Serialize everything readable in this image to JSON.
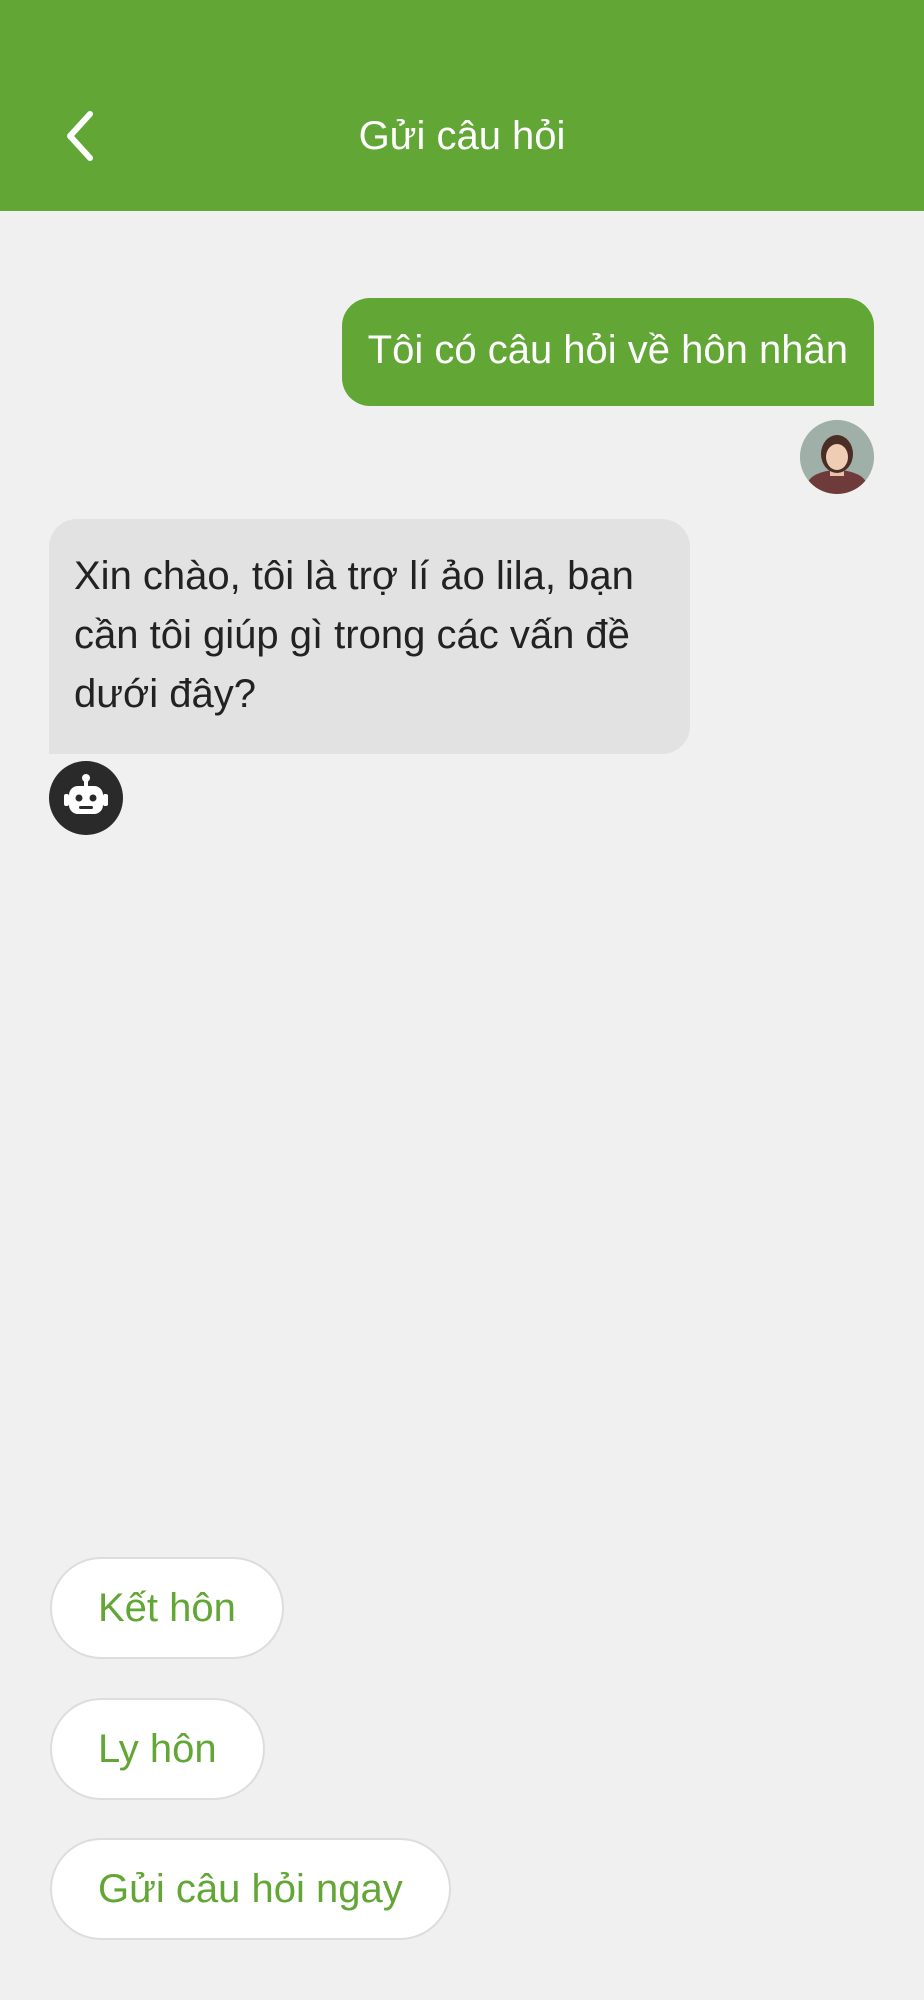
{
  "header": {
    "title": "Gửi câu hỏi",
    "background_color": "#62a636",
    "back_icon": "chevron-left-icon"
  },
  "messages": [
    {
      "sender": "user",
      "text": "Tôi có câu hỏi về hôn nhân",
      "avatar": "user-avatar-photo"
    },
    {
      "sender": "bot",
      "text": "Xin chào, tôi là trợ lí ảo lila, bạn cần tôi giúp gì trong các vấn đề dưới đây?",
      "avatar": "robot-icon"
    }
  ],
  "quick_replies": [
    {
      "label": "Kết hôn"
    },
    {
      "label": "Ly hôn"
    },
    {
      "label": "Gửi câu hỏi ngay"
    }
  ],
  "colors": {
    "accent": "#62a636",
    "page_background": "#f0f0f0",
    "bot_bubble": "#e2e2e2",
    "user_bubble_text": "#ffffff",
    "bot_bubble_text": "#222222",
    "robot_avatar": "#2a2a2a"
  }
}
